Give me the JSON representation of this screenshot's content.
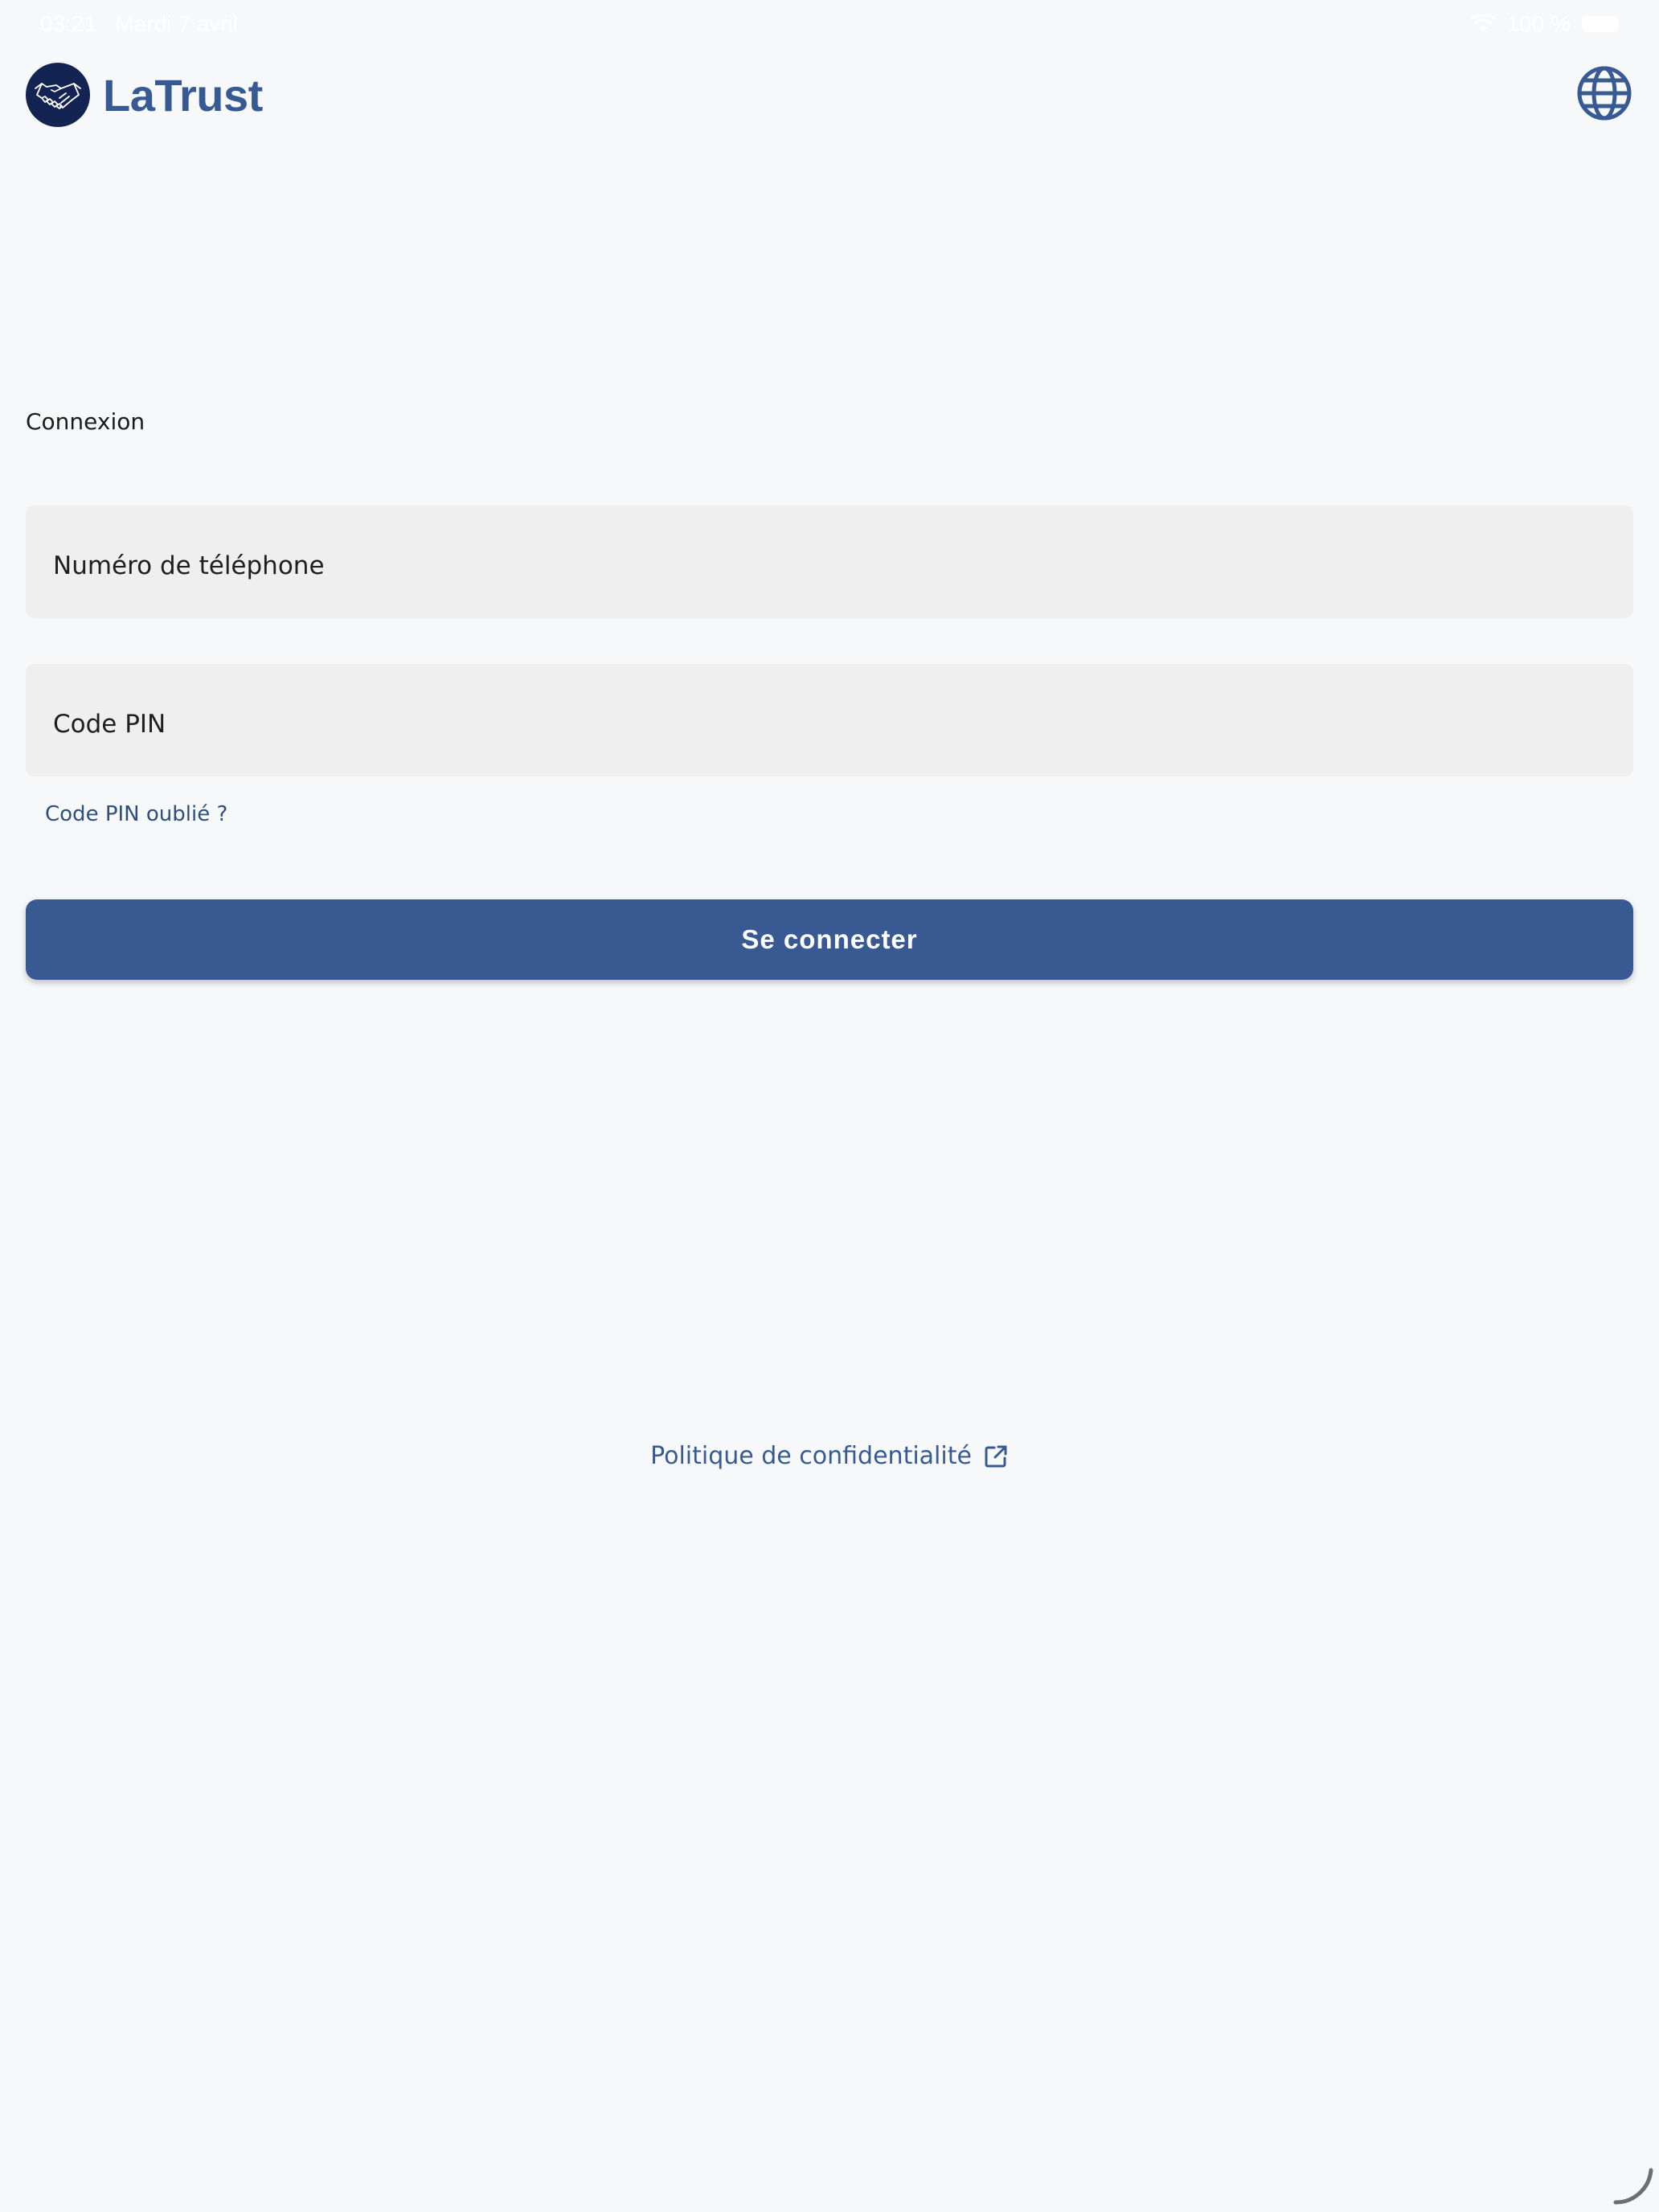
{
  "status_bar": {
    "time": "03:21",
    "date": "Mardi 7 avril",
    "battery": "100 %"
  },
  "header": {
    "brand_name": "LaTrust",
    "logo_icon": "handshake-icon",
    "language_icon": "globe-icon"
  },
  "login": {
    "title": "Connexion",
    "phone_placeholder": "Numéro de téléphone",
    "pin_placeholder": "Code PIN",
    "forgot_pin": "Code PIN oublié ?",
    "submit_label": "Se connecter"
  },
  "footer": {
    "privacy_label": "Politique de confidentialité",
    "privacy_icon": "external-link-icon"
  },
  "colors": {
    "primary": "#385991",
    "brand_text": "#375a93",
    "logo_bg": "#142452",
    "field_bg": "#efefef",
    "page_bg": "#f7f8fa"
  }
}
